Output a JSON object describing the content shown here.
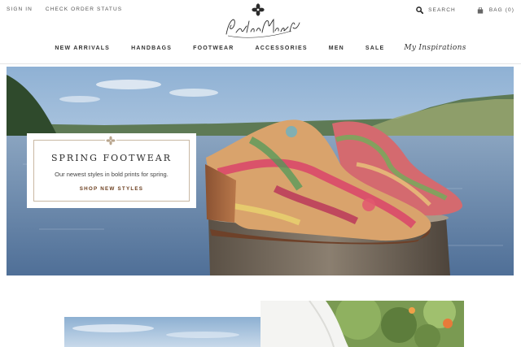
{
  "utility": {
    "sign_in": "SIGN IN",
    "check_order_status": "CHECK ORDER STATUS",
    "search_label": "SEARCH",
    "bag_label": "BAG (0)",
    "search_icon": "magnifier-icon",
    "bag_icon": "shopping-bag-icon"
  },
  "logo": {
    "text": "Patricia Nash"
  },
  "nav": {
    "items": [
      "NEW ARRIVALS",
      "HANDBAGS",
      "FOOTWEAR",
      "ACCESSORIES",
      "MEN",
      "SALE"
    ],
    "script_item": "My Inspirations"
  },
  "promo": {
    "title": "SPRING FOOTWEAR",
    "subtitle": "Our newest styles in bold prints for spring.",
    "cta": "SHOP NEW STYLES"
  },
  "colors": {
    "accent_brown": "#6b3e1e",
    "border_tan": "#c9b8a3",
    "text_dark": "#333333"
  }
}
